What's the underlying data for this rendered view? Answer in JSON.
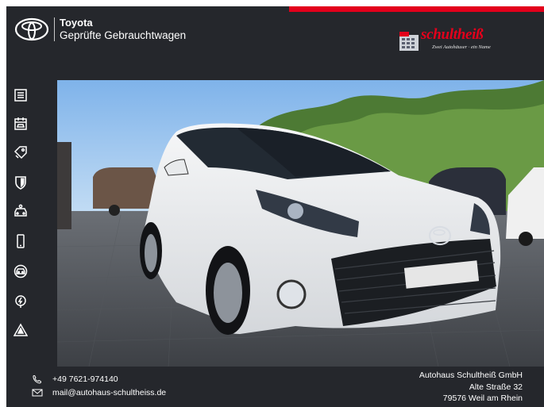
{
  "header": {
    "brand_name": "Toyota",
    "brand_subtitle": "Geprüfte Gebrauchtwagen",
    "dealer_name": "schultheiß",
    "dealer_tagline": "Zwei Autohäuser · ein Name",
    "accent_color": "#e3001b"
  },
  "sidebar": {
    "items": [
      {
        "icon": "list-icon"
      },
      {
        "icon": "car-calendar-icon"
      },
      {
        "icon": "tag-icon"
      },
      {
        "icon": "shield-icon"
      },
      {
        "icon": "car-key-icon"
      },
      {
        "icon": "smartphone-icon"
      },
      {
        "icon": "car-service-icon"
      },
      {
        "icon": "ev-charge-icon"
      },
      {
        "icon": "warning-icon"
      }
    ]
  },
  "footer": {
    "phone": "+49 7621-974140",
    "email": "mail@autohaus-schultheiss.de",
    "company": "Autohaus Schultheiß GmbH",
    "street": "Alte Straße 32",
    "city": "79576 Weil am Rhein"
  }
}
